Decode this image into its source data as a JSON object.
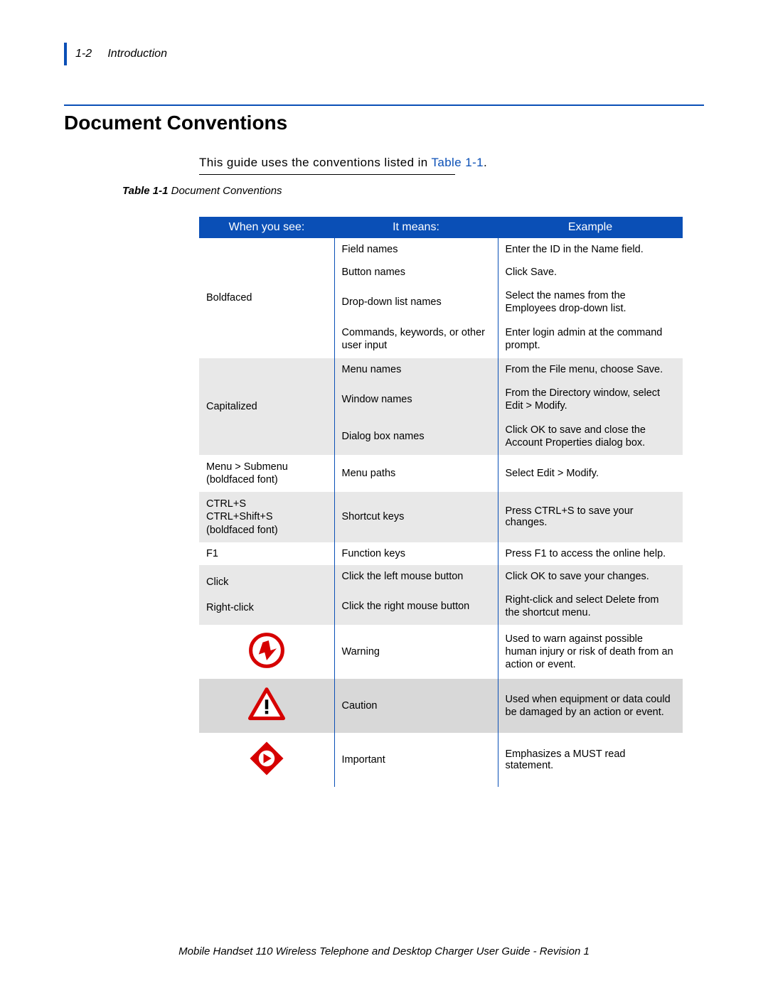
{
  "header": {
    "page_label": "1-2",
    "section": "Introduction"
  },
  "title": "Document Conventions",
  "intro": {
    "prefix": "This guide uses the conventions listed in ",
    "link": "Table 1-1",
    "suffix": "."
  },
  "caption": {
    "bold": "Table 1-1",
    "rest": "  Document Conventions"
  },
  "thead": {
    "c1": "When you see:",
    "c2": "It means:",
    "c3": "Example"
  },
  "r1": {
    "c1": "Boldfaced",
    "m1": "Field names",
    "m2": "Button names",
    "m3": "Drop-down list names",
    "m4": "Commands, keywords, or other user input",
    "e1a": "Enter the ID in the ",
    "e1b": "Name",
    "e1c": " field.",
    "e2a": "Click ",
    "e2b": "Save",
    "e2c": ".",
    "e3a": "Select the names from the ",
    "e3b": "Employees",
    "e3c": " drop-down list.",
    "e4a": "Enter ",
    "e4b": "login admin",
    "e4c": " at the command prompt."
  },
  "r2": {
    "c1": "Capitalized",
    "m1": "Menu names",
    "m2": "Window names",
    "m3": "Dialog box names",
    "e1a": "From the File menu, choose ",
    "e1b": "Save",
    "e1c": ".",
    "e2a": "From the Directory window, select ",
    "e2b": "Edit > Modify",
    "e2c": ".",
    "e3a": "Click ",
    "e3b": "OK",
    "e3c": " to save and close the Account Properties dialog box."
  },
  "r3": {
    "c1a": "Menu > Submenu",
    "c1b": "(boldfaced font)",
    "m": "Menu paths",
    "ea": "Select ",
    "eb": "Edit > Modify",
    "ec": "."
  },
  "r4": {
    "c1a": "CTRL+S",
    "c1b": "CTRL+Shift+S",
    "c1c": "(boldfaced font)",
    "m": "Shortcut keys",
    "ea": "Press ",
    "eb": "CTRL+S",
    "ec": " to save your changes."
  },
  "r5": {
    "c1": "F1",
    "m": "Function keys",
    "ea": "Press ",
    "eb": "F1",
    "ec": " to access the online help."
  },
  "r6": {
    "c1a": "Click",
    "c1b": "Right-click",
    "m1": "Click the left mouse button",
    "m2": "Click the right mouse button",
    "e1a": "Click ",
    "e1b": "OK",
    "e1c": " to save your changes.",
    "e2a": "Right-click and select ",
    "e2b": "Delete",
    "e2c": " from the shortcut menu."
  },
  "r7": {
    "m": "Warning",
    "e": "Used to warn against possible human injury or risk of death from an action or event."
  },
  "r8": {
    "m": "Caution",
    "e": "Used when equipment or data could be damaged by an action or event."
  },
  "r9": {
    "m": "Important",
    "ea": "Emphasizes a ",
    "eb": "MUST",
    "ec": " read statement."
  },
  "footer": "Mobile Handset 110 Wireless Telephone and Desktop Charger User Guide - Revision 1"
}
